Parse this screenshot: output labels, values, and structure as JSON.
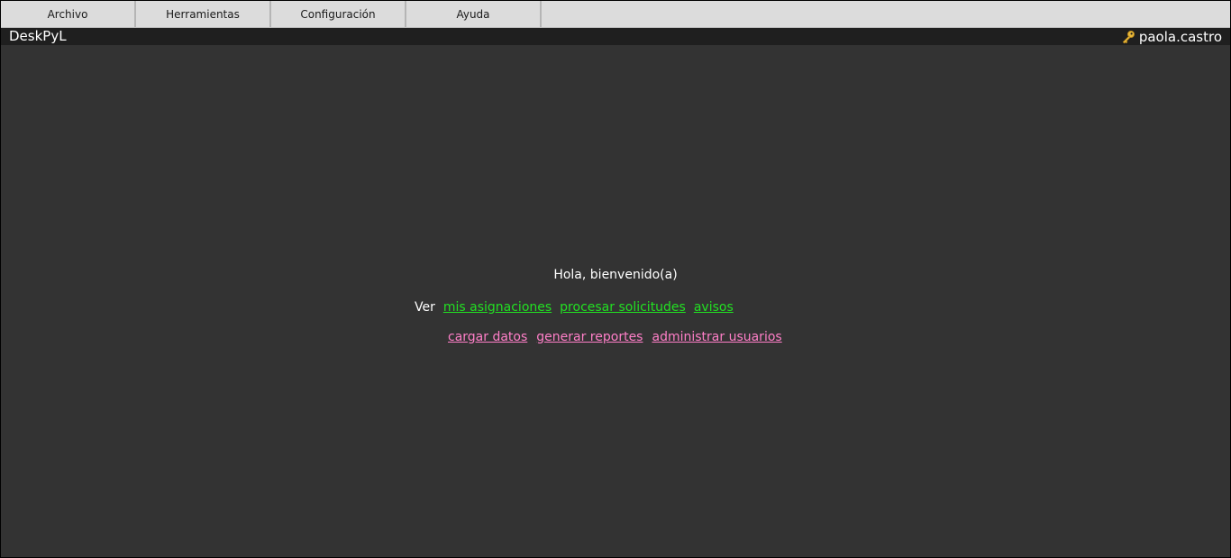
{
  "menu": {
    "items": [
      {
        "label": "Archivo"
      },
      {
        "label": "Herramientas"
      },
      {
        "label": "Configuración"
      },
      {
        "label": "Ayuda"
      }
    ]
  },
  "titlebar": {
    "app_name": "DeskPyL",
    "username": "paola.castro",
    "user_icon": "key-icon"
  },
  "main": {
    "greeting": "Hola, bienvenido(a)",
    "ver_label": "Ver",
    "links_primary": [
      {
        "label": "mis asignaciones"
      },
      {
        "label": "procesar solicitudes"
      },
      {
        "label": "avisos"
      }
    ],
    "links_secondary": [
      {
        "label": "cargar datos"
      },
      {
        "label": "generar reportes"
      },
      {
        "label": "administrar usuarios"
      }
    ]
  },
  "colors": {
    "background": "#333333",
    "titlebar": "#1f1f1f",
    "menubar": "#dcdcdc",
    "link_primary": "#22e022",
    "link_secondary": "#ff7fc8"
  }
}
